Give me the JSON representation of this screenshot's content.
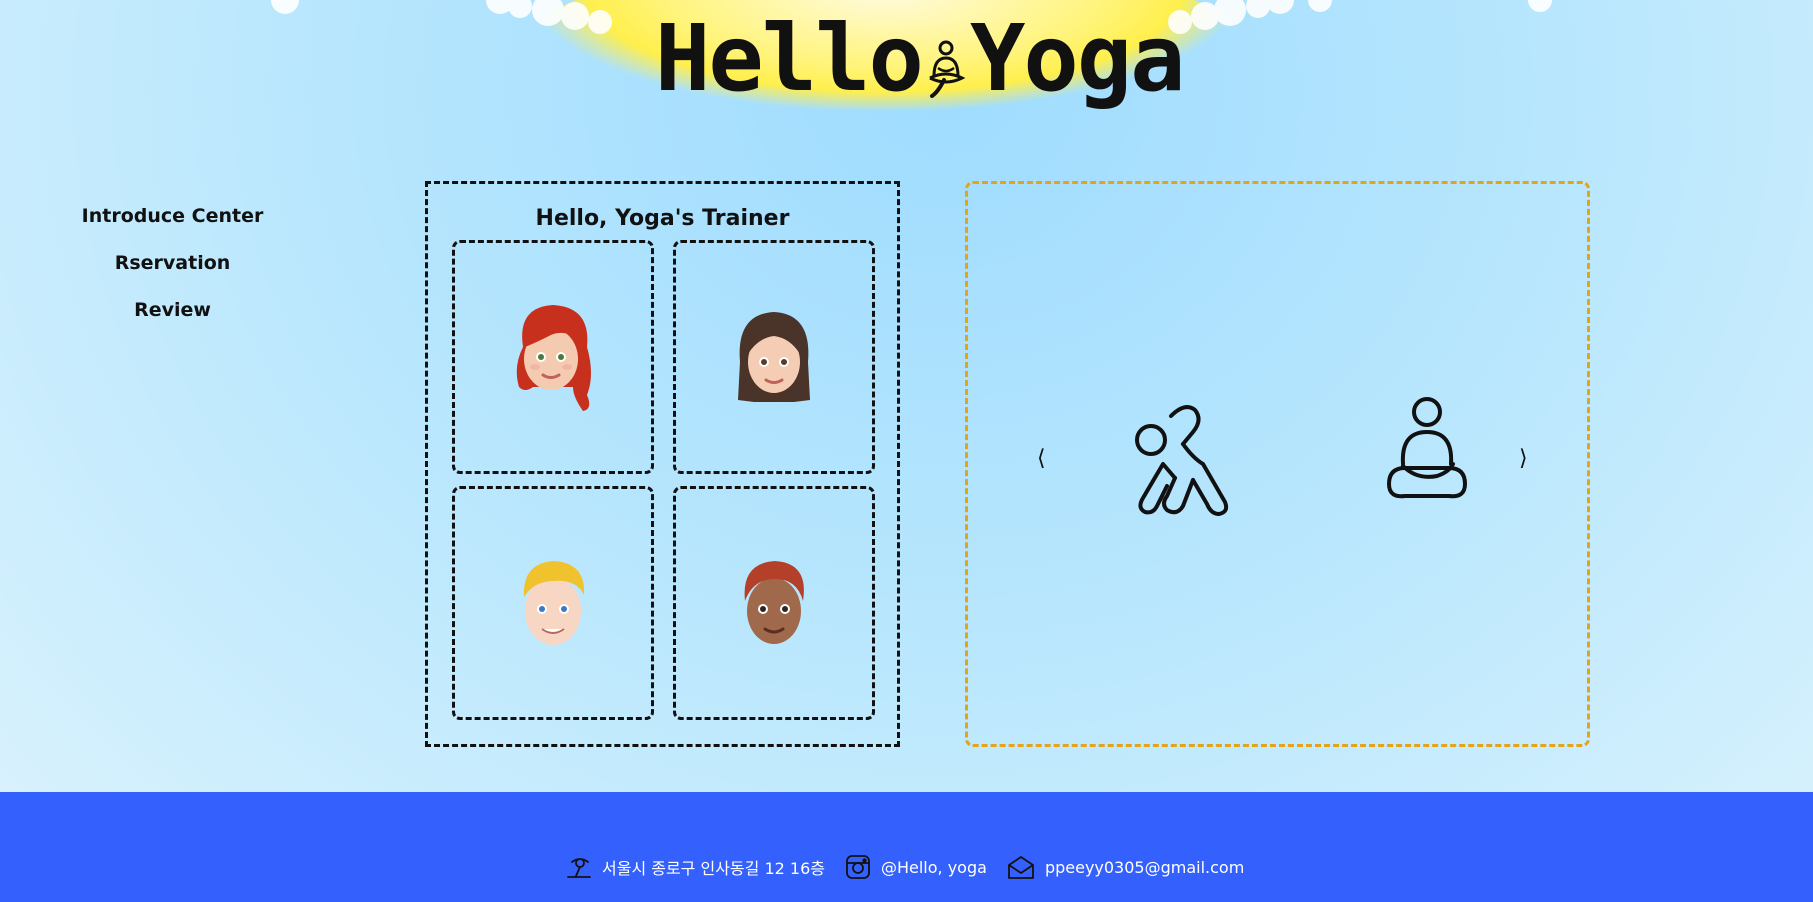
{
  "logo": {
    "left": "Hello",
    "right": "Yoga",
    "icon": "meditation-icon"
  },
  "nav": {
    "items": [
      {
        "label": "Introduce Center"
      },
      {
        "label": "Rservation"
      },
      {
        "label": "Review"
      }
    ]
  },
  "trainers": {
    "title": "Hello, Yoga's Trainer",
    "cards": [
      {
        "avatar": "red-hair-woman-avatar"
      },
      {
        "avatar": "brown-hair-woman-avatar"
      },
      {
        "avatar": "blond-man-avatar"
      },
      {
        "avatar": "auburn-hair-man-avatar"
      }
    ]
  },
  "slider": {
    "prev_label": "⟨",
    "next_label": "⟩",
    "slides": [
      {
        "icon": "yoga-stretch-pose-icon"
      },
      {
        "icon": "meditation-pose-icon"
      }
    ]
  },
  "footer": {
    "address": "서울시 종로구 인사동길 12 16층",
    "instagram": "@Hello, yoga",
    "email": "ppeeyy0305@gmail.com"
  },
  "colors": {
    "footer_bg": "#3461fd",
    "slider_border": "#e3a41a",
    "sun": "#ffef4d"
  }
}
